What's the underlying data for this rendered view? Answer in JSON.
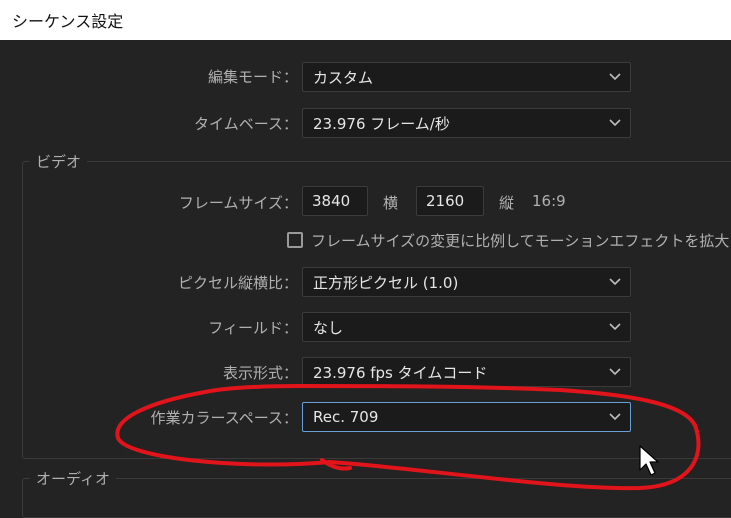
{
  "window": {
    "title": "シーケンス設定"
  },
  "general": {
    "edit_mode": {
      "label": "編集モード：",
      "value": "カスタム"
    },
    "timebase": {
      "label": "タイムベース：",
      "value": "23.976  フレーム/秒"
    }
  },
  "video": {
    "section_title": "ビデオ",
    "frame_size": {
      "label": "フレームサイズ：",
      "width": "3840",
      "width_unit": "横",
      "height": "2160",
      "height_unit": "縦",
      "aspect": "16:9"
    },
    "scale_checkbox": {
      "label": "フレームサイズの変更に比例してモーションエフェクトを拡大",
      "checked": false
    },
    "pixel_aspect": {
      "label": "ピクセル縦横比：",
      "value": "正方形ピクセル (1.0)"
    },
    "fields": {
      "label": "フィールド：",
      "value": "なし"
    },
    "display_format": {
      "label": "表示形式：",
      "value": "23.976  fps タイムコード"
    },
    "working_color_space": {
      "label": "作業カラースペース：",
      "value": "Rec. 709"
    }
  },
  "audio": {
    "section_title": "オーディオ"
  },
  "colors": {
    "annotation": "#e0141a",
    "focus": "#6aa0d8"
  }
}
